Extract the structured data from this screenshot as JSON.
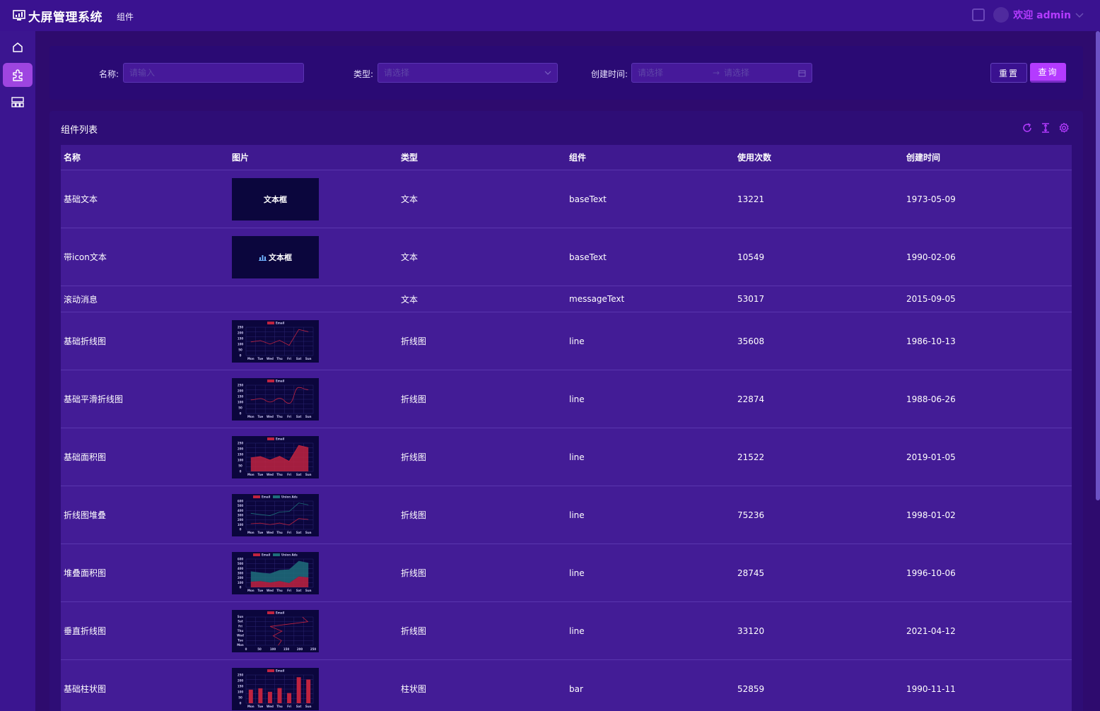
{
  "app": {
    "title": "大屏管理系统",
    "breadcrumb": "组件"
  },
  "user": {
    "greeting": "欢迎 admin"
  },
  "colors": {
    "accent": "#b43bff",
    "background": "#2e0b6e",
    "email_series": "#c0233f",
    "union_series": "#1e6f7a"
  },
  "sidebar": {
    "items": [
      {
        "icon": "home-icon"
      },
      {
        "icon": "component-icon",
        "active": true
      },
      {
        "icon": "screen-layout-icon"
      }
    ]
  },
  "filter": {
    "name_label": "名称:",
    "name_placeholder": "请输入",
    "type_label": "类型:",
    "type_placeholder": "请选择",
    "created_label": "创建时间:",
    "start_placeholder": "请选择",
    "end_placeholder": "请选择",
    "reset_label": "重置",
    "query_label": "查询"
  },
  "list": {
    "title": "组件列表",
    "columns": [
      "名称",
      "图片",
      "类型",
      "组件",
      "使用次数",
      "创建时间"
    ],
    "rows": [
      {
        "name": "基础文本",
        "thumb": "text",
        "thumb_text": "文本框",
        "type": "文本",
        "component": "baseText",
        "uses": "13221",
        "created": "1973-05-09"
      },
      {
        "name": "带icon文本",
        "thumb": "icontext",
        "thumb_text": "文本框",
        "type": "文本",
        "component": "baseText",
        "uses": "10549",
        "created": "1990-02-06"
      },
      {
        "name": "滚动消息",
        "thumb": "none",
        "type": "文本",
        "component": "messageText",
        "uses": "53017",
        "created": "2015-09-05"
      },
      {
        "name": "基础折线图",
        "thumb": "line",
        "type": "折线图",
        "component": "line",
        "uses": "35608",
        "created": "1986-10-13"
      },
      {
        "name": "基础平滑折线图",
        "thumb": "smooth",
        "type": "折线图",
        "component": "line",
        "uses": "22874",
        "created": "1988-06-26"
      },
      {
        "name": "基础面积图",
        "thumb": "area",
        "type": "折线图",
        "component": "line",
        "uses": "21522",
        "created": "2019-01-05"
      },
      {
        "name": "折线图堆叠",
        "thumb": "stackline",
        "type": "折线图",
        "component": "line",
        "uses": "75236",
        "created": "1998-01-02"
      },
      {
        "name": "堆叠面积图",
        "thumb": "stackarea",
        "type": "折线图",
        "component": "line",
        "uses": "28745",
        "created": "1996-10-06"
      },
      {
        "name": "垂直折线图",
        "thumb": "vertical",
        "type": "折线图",
        "component": "line",
        "uses": "33120",
        "created": "2021-04-12"
      },
      {
        "name": "基础柱状图",
        "thumb": "bar",
        "type": "柱状图",
        "component": "bar",
        "uses": "52859",
        "created": "1990-11-11"
      }
    ]
  },
  "thumb_chart": {
    "days": [
      "Mon",
      "Tue",
      "Wed",
      "Thu",
      "Fri",
      "Sat",
      "Sun"
    ],
    "y_ticks": [
      "250",
      "200",
      "150",
      "100",
      "50",
      "0"
    ],
    "y_ticks_stack": [
      "600",
      "500",
      "400",
      "300",
      "200",
      "100",
      "0"
    ],
    "x_ticks_value": [
      "0",
      "50",
      "100",
      "150",
      "200",
      "250"
    ],
    "email_legend": "Email",
    "union_legend": "Union Ads",
    "email_values": [
      120,
      132,
      101,
      134,
      90,
      230,
      210
    ],
    "union_values": [
      220,
      182,
      191,
      234,
      290,
      330,
      310
    ]
  }
}
